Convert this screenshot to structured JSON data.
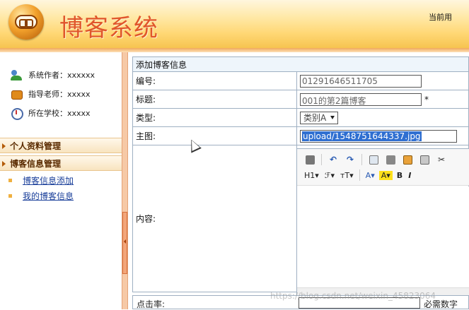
{
  "header": {
    "app_title": "博客系统",
    "current_user": "当前用"
  },
  "sidebar": {
    "info": [
      {
        "icon": "author-icon",
        "text": "系统作者：xxxxxx"
      },
      {
        "icon": "teacher-icon",
        "text": "指导老师：xxxxx"
      },
      {
        "icon": "school-icon",
        "text": "所在学校：xxxxx"
      }
    ],
    "menus": [
      {
        "label": "个人资料管理"
      },
      {
        "label": "博客信息管理",
        "items": [
          {
            "label": "博客信息添加"
          },
          {
            "label": "我的博客信息"
          }
        ]
      }
    ]
  },
  "form": {
    "title": "添加博客信息",
    "fields": {
      "serial": {
        "label": "编号:",
        "value": "01291646511705"
      },
      "title": {
        "label": "标题:",
        "value": "001的第2篇博客",
        "required_mark": "*"
      },
      "type": {
        "label": "类型:",
        "value": "类别A"
      },
      "image": {
        "label": "主图:",
        "value": "upload/1548751644337.jpg"
      },
      "content": {
        "label": "内容:"
      },
      "clicks": {
        "label": "点击率:",
        "hint": "必需数字"
      }
    }
  },
  "editor": {
    "toolbar_row1": [
      "source-icon",
      "undo-icon",
      "redo-icon",
      "preview-icon",
      "print-icon",
      "template-icon",
      "code-icon",
      "cut-icon"
    ],
    "toolbar_row2": [
      "H1",
      "ℱ",
      "тT",
      "A",
      "A",
      "B",
      "I"
    ]
  },
  "watermark": "https://blog.csdn.net/weixin_45823064"
}
